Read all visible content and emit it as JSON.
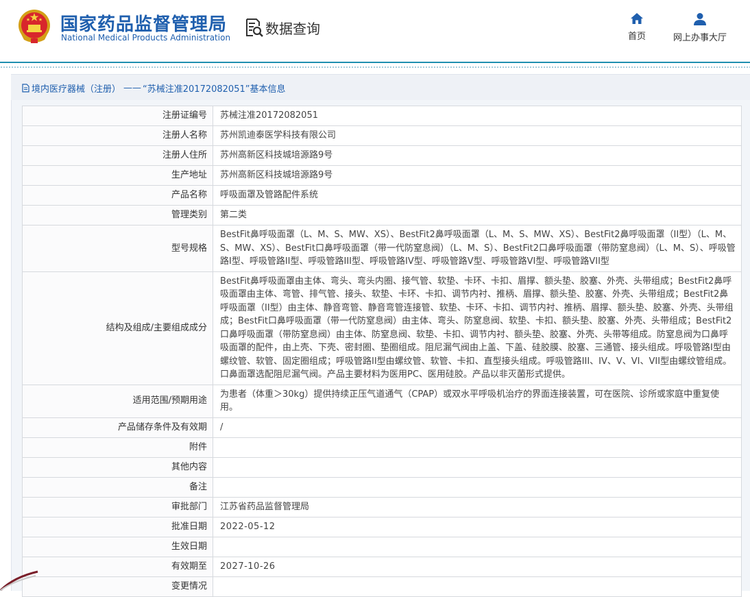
{
  "header": {
    "brand_cn": "国家药品监督管理局",
    "brand_en": "National Medical Products Administration",
    "query_title": "数据查询",
    "nav": [
      {
        "label": "首页",
        "icon": "home-icon"
      },
      {
        "label": "网上办事大厅",
        "icon": "user-icon"
      }
    ]
  },
  "breadcrumb": {
    "category": "境内医疗器械（注册）",
    "separator": "——",
    "title": "“苏械注准20172082051”基本信息"
  },
  "colors": {
    "brand_blue": "#1f5fae",
    "header_line": "#1f8fb0",
    "panel_bg": "#f2f5f9"
  },
  "rows": [
    {
      "label": "注册证编号",
      "value": "苏械注准20172082051"
    },
    {
      "label": "注册人名称",
      "value": "苏州凯迪泰医学科技有限公司"
    },
    {
      "label": "注册人住所",
      "value": "苏州高新区科技城培源路9号"
    },
    {
      "label": "生产地址",
      "value": "苏州高新区科技城培源路9号"
    },
    {
      "label": "产品名称",
      "value": "呼吸面罩及管路配件系统"
    },
    {
      "label": "管理类别",
      "value": "第二类"
    },
    {
      "label": "型号规格",
      "value": "BestFit鼻呼吸面罩（L、M、S、MW、XS）、BestFit2鼻呼吸面罩（L、M、S、MW、XS）、BestFit2鼻呼吸面罩（II型）（L、M、S、MW、XS）、BestFit口鼻呼吸面罩（带一代防窒息阀）（L、M、S）、BestFit2口鼻呼吸面罩（带防窒息阀）（L、M、S）、呼吸管路I型、呼吸管路II型、呼吸管路III型、呼吸管路IV型、呼吸管路V型、呼吸管路VI型、呼吸管路VII型"
    },
    {
      "label": "结构及组成/主要组成成分",
      "value": "BestFit鼻呼吸面罩由主体、弯头、弯头内圈、接气管、软垫、卡环、卡扣、眉撑、额头垫、胶塞、外壳、头带组成；BestFit2鼻呼吸面罩由主体、弯管、排气管、接头、软垫、卡环、卡扣、调节内衬、推柄、眉撑、额头垫、胶塞、外壳、头带组成；BestFit2鼻呼吸面罩（II型）由主体、静音弯管、静音弯管连接管、软垫、卡环、卡扣、调节内衬、推柄、眉撑、额头垫、胶塞、外壳、头带组成；BestFit口鼻呼吸面罩（带一代防窒息阀）由主体、弯头、防窒息阀、软垫、卡扣、额头垫、胶塞、外壳、头带组成；BestFit2口鼻呼吸面罩（带防窒息阀）由主体、防窒息阀、软垫、卡扣、调节内衬、额头垫、胶塞、外壳、头带等组成。防窒息阀为口鼻呼吸面罩的配件，由上壳、下壳、密封圈、垫圈组成。阻尼漏气阀由上盖、下盖、硅胶膜、胶塞、三通管、接头组成。呼吸管路I型由螺纹管、软管、固定圈组成；呼吸管路II型由螺纹管、软管、卡扣、直型接头组成。呼吸管路III、IV、V、VI、VII型由螺纹管组成。口鼻面罩选配阻尼漏气阀。产品主要材料为医用PC、医用硅胶。产品以非灭菌形式提供。"
    },
    {
      "label": "适用范围/预期用途",
      "value": "为患者（体重＞30kg）提供持续正压气道通气（CPAP）或双水平呼吸机治疗的界面连接装置，可在医院、诊所或家庭中重复使用。"
    },
    {
      "label": "产品储存条件及有效期",
      "value": "/"
    },
    {
      "label": "附件",
      "value": ""
    },
    {
      "label": "其他内容",
      "value": ""
    },
    {
      "label": "备注",
      "value": ""
    },
    {
      "label": "审批部门",
      "value": "江苏省药品监督管理局"
    },
    {
      "label": "批准日期",
      "value": "2022-05-12"
    },
    {
      "label": "生效日期",
      "value": ""
    },
    {
      "label": "有效期至",
      "value": "2027-10-26"
    },
    {
      "label": "变更情况",
      "value": ""
    }
  ]
}
